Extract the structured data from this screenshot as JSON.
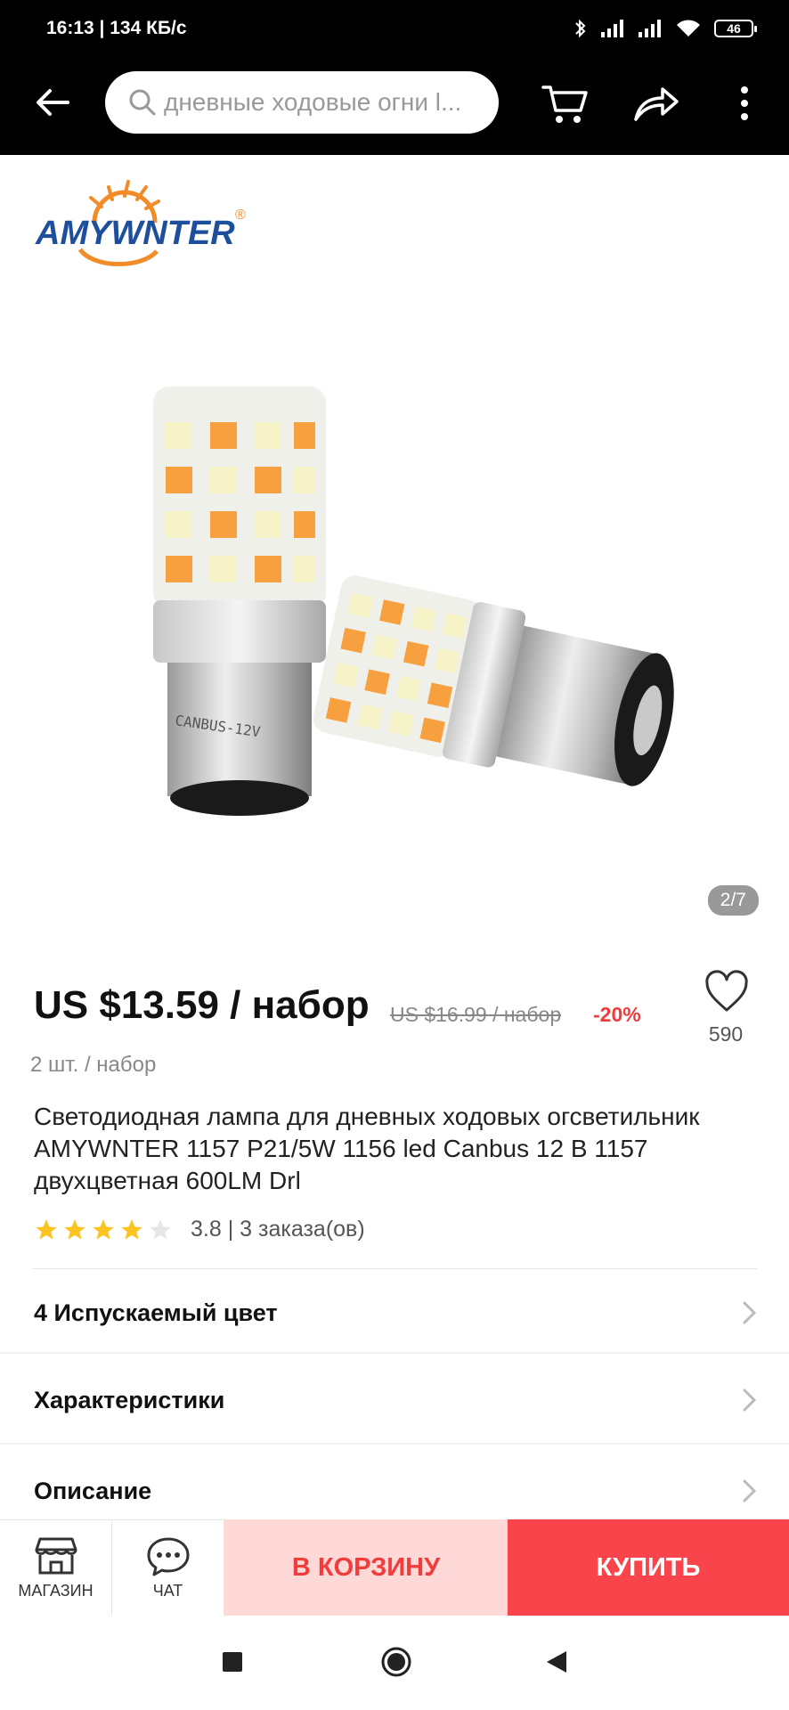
{
  "status_bar": {
    "time": "16:13 | 134 КБ/с",
    "battery": "46"
  },
  "header": {
    "search_placeholder": "дневные ходовые огни l..."
  },
  "brand": {
    "logo_text": "AMYWNTER"
  },
  "gallery": {
    "pager": "2/7",
    "current": 2,
    "total": 7
  },
  "product": {
    "price": "US $13.59 / набор",
    "old_price": "US $16.99 / набор",
    "discount": "-20%",
    "wishlist_count": "590",
    "pack": "2 шт. / набор",
    "title": "Светодиодная лампа для дневных ходовых огсветильник AMYWNTER 1157 P21/5W 1156 led Canbus 12 В 1157 двухцветная 600LM Drl",
    "rating_value": 3.8,
    "rating_text": "3.8 | 3 заказа(ов)"
  },
  "sections": [
    {
      "label": "4 Испускаемый цвет"
    },
    {
      "label": "Характеристики"
    },
    {
      "label": "Описание"
    }
  ],
  "actions": {
    "store_label": "МАГАЗИН",
    "chat_label": "ЧАТ",
    "cart_label": "В КОРЗИНУ",
    "buy_label": "КУПИТЬ"
  },
  "colors": {
    "accent": "#f8444a",
    "cart_bg": "#ffd8d8",
    "star": "#ffc31f",
    "discount": "#f03b3b"
  }
}
